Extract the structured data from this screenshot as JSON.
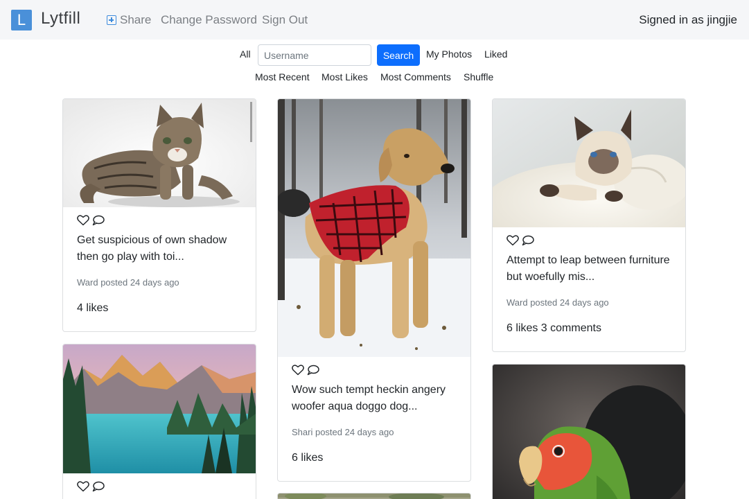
{
  "nav": {
    "logo_letter": "L",
    "brand": "Lytfill",
    "share": "Share",
    "change_password": "Change Password",
    "sign_out": "Sign Out",
    "signed_in": "Signed in as jingjie"
  },
  "filters": {
    "all": "All",
    "username_placeholder": "Username",
    "search": "Search",
    "my_photos": "My Photos",
    "liked": "Liked",
    "most_recent": "Most Recent",
    "most_likes": "Most Likes",
    "most_comments": "Most Comments",
    "shuffle": "Shuffle"
  },
  "posts": [
    {
      "image": "kitten-photo",
      "caption": "Get suspicious of own shadow then go play with toi...",
      "posted": "Ward posted 24 days ago",
      "stats": "4 likes"
    },
    {
      "image": "lake-photo",
      "caption": "",
      "posted": "",
      "stats": ""
    },
    {
      "image": "dog-photo",
      "caption": "Wow such tempt heckin angery woofer aqua doggo dog...",
      "posted": "Shari posted 24 days ago",
      "stats": "6 likes"
    },
    {
      "image": "cat-photo",
      "caption": "Attempt to leap between furniture but woefully mis...",
      "posted": "Ward posted 24 days ago",
      "stats": "6 likes 3 comments"
    },
    {
      "image": "parrot-photo",
      "caption": "",
      "posted": "",
      "stats": ""
    }
  ],
  "icons": {
    "like": "heart-outline-icon",
    "comment": "comment-outline-icon",
    "share": "plus-square-icon"
  },
  "colors": {
    "navbar_bg": "#f5f6f8",
    "logo": "#4a90d9",
    "search_button": "#0d6efd"
  }
}
